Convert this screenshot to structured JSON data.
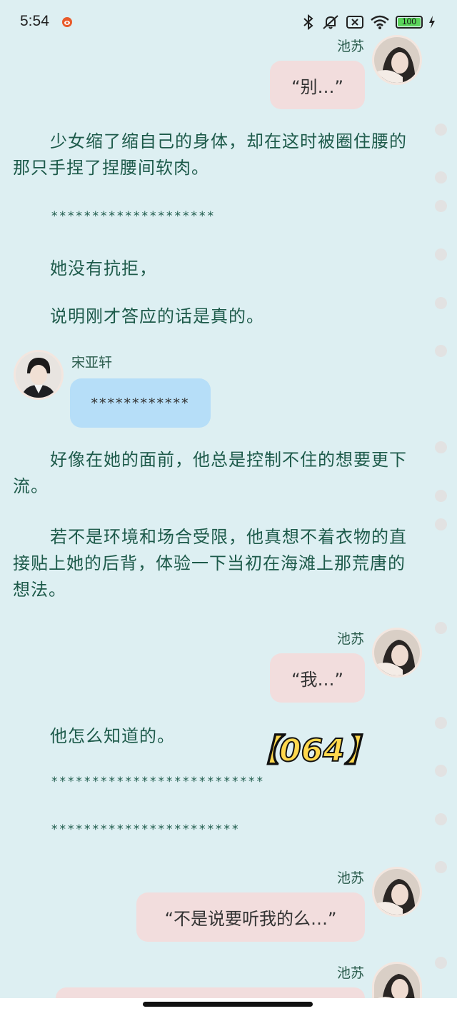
{
  "status_bar": {
    "time": "5:54",
    "battery": "100"
  },
  "chapter_tag": "【064】",
  "messages": {
    "m1": {
      "name": "池苏",
      "text": "“别…”"
    },
    "m2": {
      "name": "宋亚轩",
      "text": "************"
    },
    "m3": {
      "name": "池苏",
      "text": "“我…”"
    },
    "m4": {
      "name": "池苏",
      "text": "“不是说要听我的么…”"
    },
    "m5": {
      "name": "池苏"
    }
  },
  "paragraphs": {
    "p1": "少女缩了缩自己的身体，却在这时被圈住腰的那只手捏了捏腰间软肉。",
    "stars1": "********************",
    "p2": "她没有抗拒，",
    "p3": "说明刚才答应的话是真的。",
    "p4": "好像在她的面前，他总是控制不住的想要更下流。",
    "p5": "若不是环境和场合受限，他真想不着衣物的直接贴上她的后背，体验一下当初在海滩上那荒唐的想法。",
    "p6": "他怎么知道的。",
    "stars2": "**************************",
    "stars3": "***********************"
  },
  "colors": {
    "background": "#ddeff2",
    "text": "#1d5a4a",
    "bubble_right": "#f2dddd",
    "bubble_left": "#b6def8"
  }
}
